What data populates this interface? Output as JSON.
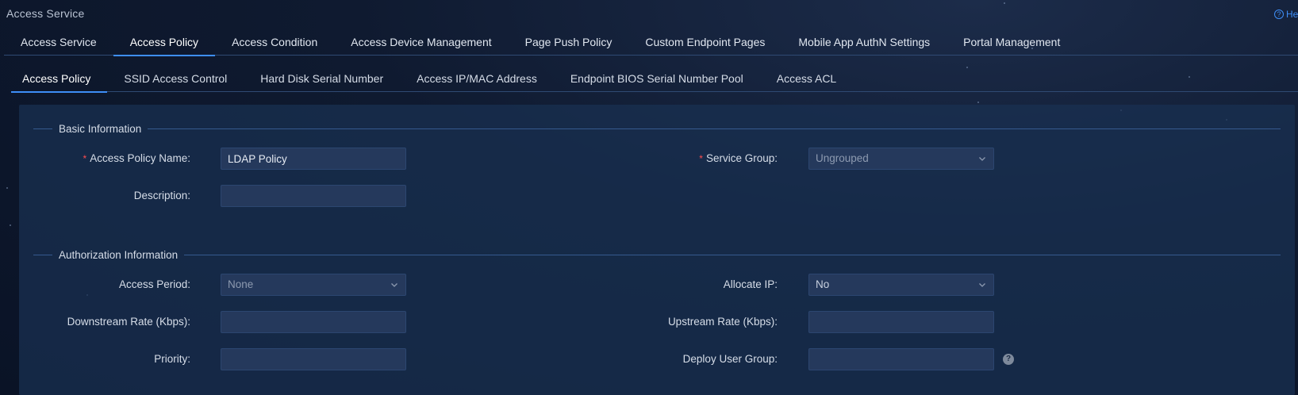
{
  "app": {
    "title": "Access Service",
    "help_label": "Help"
  },
  "primary_tabs": [
    {
      "label": "Access Service",
      "active": false
    },
    {
      "label": "Access Policy",
      "active": true
    },
    {
      "label": "Access Condition",
      "active": false
    },
    {
      "label": "Access Device Management",
      "active": false
    },
    {
      "label": "Page Push Policy",
      "active": false
    },
    {
      "label": "Custom Endpoint Pages",
      "active": false
    },
    {
      "label": "Mobile App AuthN Settings",
      "active": false
    },
    {
      "label": "Portal Management",
      "active": false
    }
  ],
  "secondary_tabs": [
    {
      "label": "Access Policy",
      "active": true
    },
    {
      "label": "SSID Access Control",
      "active": false
    },
    {
      "label": "Hard Disk Serial Number",
      "active": false
    },
    {
      "label": "Access IP/MAC Address",
      "active": false
    },
    {
      "label": "Endpoint BIOS Serial Number Pool",
      "active": false
    },
    {
      "label": "Access ACL",
      "active": false
    }
  ],
  "basic_info": {
    "title": "Basic Information",
    "policy_name": {
      "label": "Access Policy Name",
      "value": "LDAP Policy",
      "required": true
    },
    "service_group": {
      "label": "Service Group",
      "value": "Ungrouped",
      "required": true
    },
    "description": {
      "label": "Description",
      "value": ""
    }
  },
  "auth_info": {
    "title": "Authorization Information",
    "access_period": {
      "label": "Access Period",
      "value": "None"
    },
    "allocate_ip": {
      "label": "Allocate IP",
      "value": "No"
    },
    "downstream_rate": {
      "label": "Downstream Rate (Kbps)",
      "value": ""
    },
    "upstream_rate": {
      "label": "Upstream Rate (Kbps)",
      "value": ""
    },
    "priority": {
      "label": "Priority",
      "value": ""
    },
    "deploy_user_group": {
      "label": "Deploy User Group",
      "value": ""
    }
  },
  "colors": {
    "accent": "#3e8ef7",
    "required": "#ff4d4f",
    "panel": "#193052"
  }
}
